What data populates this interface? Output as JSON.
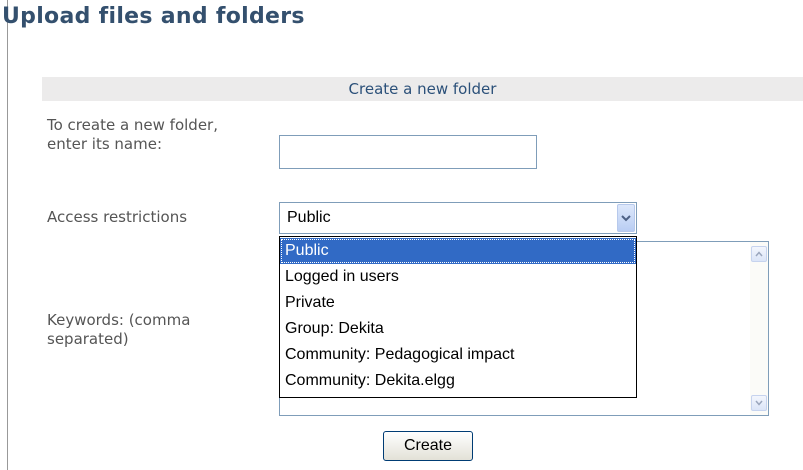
{
  "page": {
    "title": "Upload files and folders"
  },
  "section": {
    "header": "Create a new folder"
  },
  "form": {
    "folder_name_label": "To create a new folder, enter its name:",
    "folder_name_value": "",
    "access_label": "Access restrictions",
    "access_selected": "Public",
    "access_options": [
      "Public",
      "Logged in users",
      "Private",
      "Group: Dekita",
      "Community: Pedagogical impact",
      "Community: Dekita.elgg"
    ],
    "keywords_label": "Keywords: (comma separated)",
    "create_label": "Create"
  },
  "colors": {
    "title": "#34506e",
    "section_bg": "#ecebeb",
    "selected_option": "#316ac5"
  },
  "icons": [
    "chevron-down-icon",
    "scroll-up-arrow-icon",
    "scroll-down-arrow-icon"
  ]
}
